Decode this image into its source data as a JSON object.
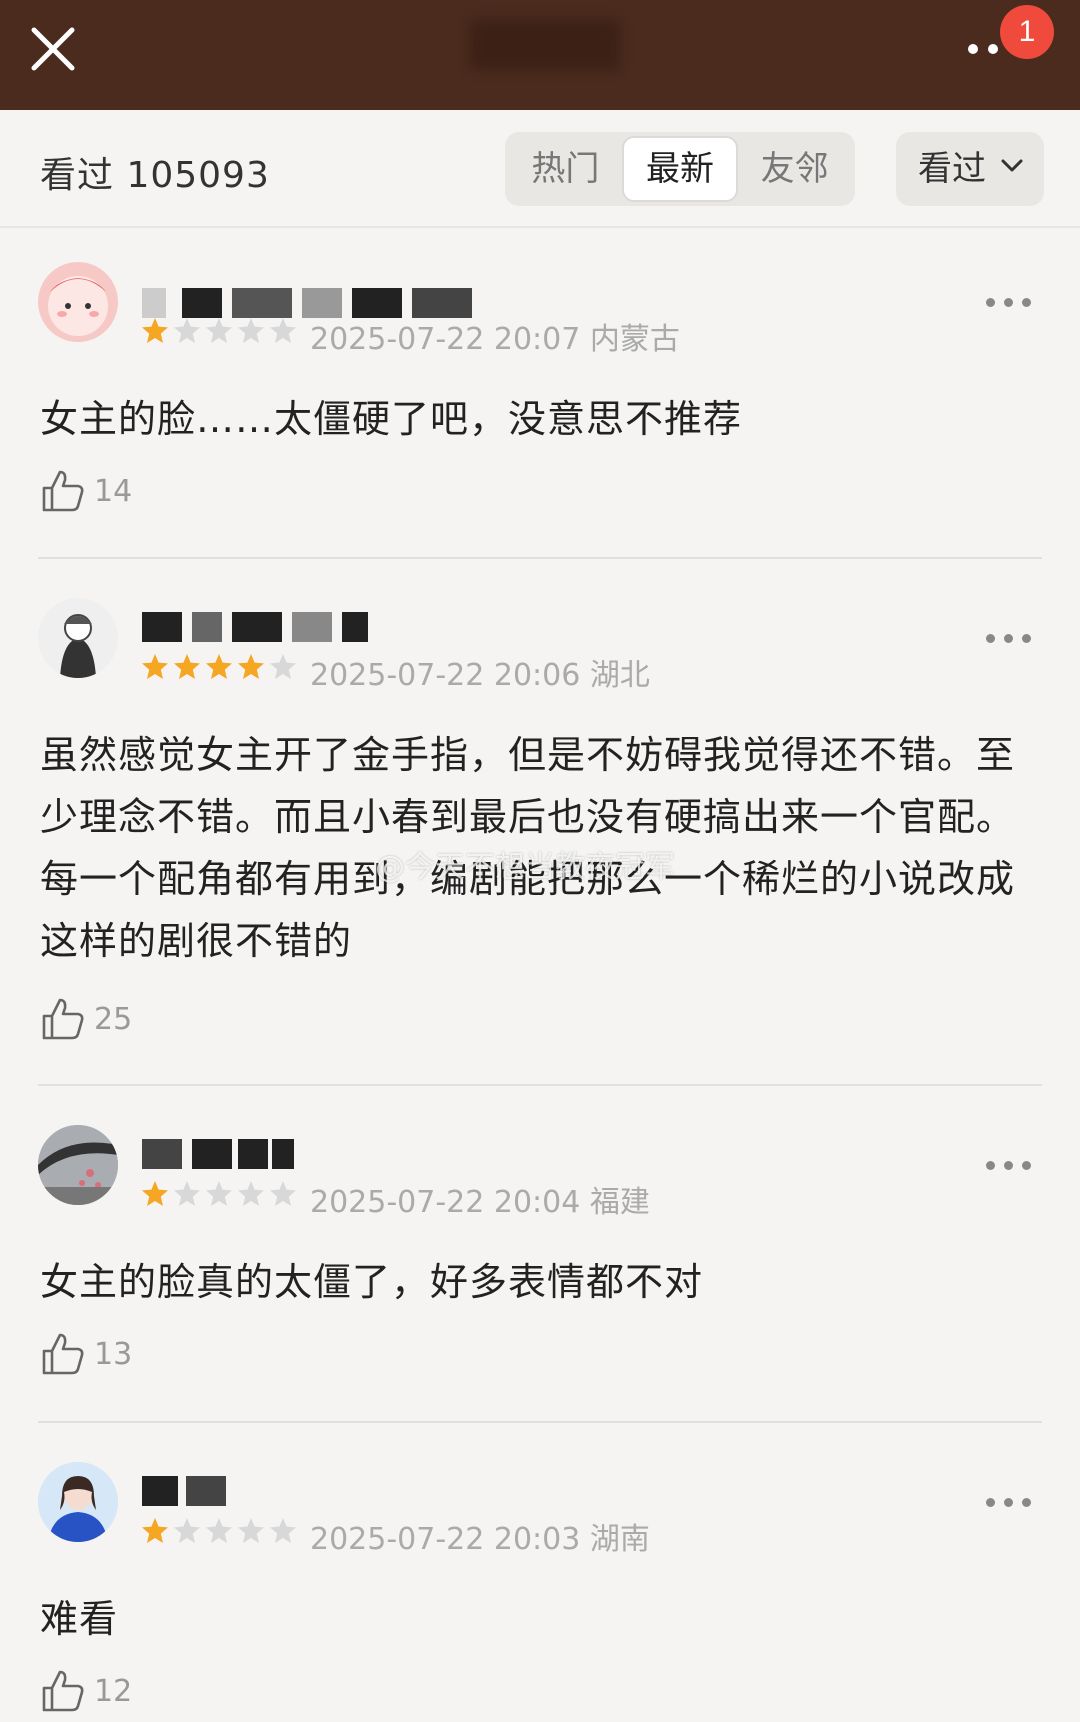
{
  "header": {
    "badge_count": "1"
  },
  "filter": {
    "watched_label": "看过 105093",
    "tabs": [
      "热门",
      "最新",
      "友邻"
    ],
    "active_tab": "最新",
    "dropdown_label": "看过"
  },
  "comments": [
    {
      "rating": 1,
      "date": "2025-07-22 20:07",
      "location": "内蒙古",
      "text": "女主的脸……太僵硬了吧，没意思不推荐",
      "likes": "14"
    },
    {
      "rating": 4,
      "date": "2025-07-22 20:06",
      "location": "湖北",
      "text": "虽然感觉女主开了金手指，但是不妨碍我觉得还不错。至少理念不错。而且小春到最后也没有硬搞出来一个官配。每一个配角都有用到，编剧能把那么一个稀烂的小说改成这样的剧很不错的",
      "likes": "25"
    },
    {
      "rating": 1,
      "date": "2025-07-22 20:04",
      "location": "福建",
      "text": "女主的脸真的太僵了，好多表情都不对",
      "likes": "13"
    },
    {
      "rating": 1,
      "date": "2025-07-22 20:03",
      "location": "湖南",
      "text": "难看",
      "likes": "12"
    }
  ],
  "watermark": "@今天不想当教夜冠军",
  "colors": {
    "topbar": "#4a2b1e",
    "star_on": "#f5a623",
    "star_off": "#d8d8d8",
    "badge": "#ef4a3c"
  }
}
